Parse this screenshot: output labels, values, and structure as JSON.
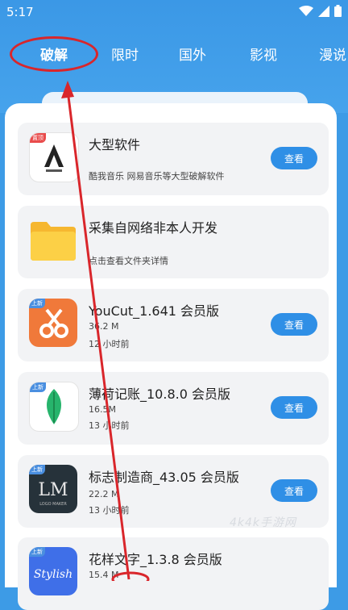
{
  "status": {
    "time": "5:17"
  },
  "tabs": [
    {
      "label": "破解",
      "active": true
    },
    {
      "label": "限时"
    },
    {
      "label": "国外"
    },
    {
      "label": "影视"
    },
    {
      "label": "漫说"
    }
  ],
  "items": [
    {
      "title": "大型软件",
      "line1": "酷我音乐 网易音乐等大型破解软件",
      "line2": "",
      "tag": "置顶",
      "icon": "a-logo-icon",
      "button": "查看"
    },
    {
      "title": "采集自网络非本人开发",
      "line1": "点击查看文件夹详情",
      "line2": "",
      "tag": "",
      "icon": "folder-icon",
      "button": ""
    },
    {
      "title": "YouCut_1.641 会员版",
      "line1": "36.2 M",
      "line2": "12 小时前",
      "tag": "上新",
      "icon": "scissors-icon",
      "button": "查看"
    },
    {
      "title": "薄荷记账_10.8.0 会员版",
      "line1": "16.5M",
      "line2": "13 小时前",
      "tag": "上新",
      "icon": "leaf-icon",
      "button": "查看"
    },
    {
      "title": "标志制造商_43.05 会员版",
      "line1": "22.2 M",
      "line2": "13 小时前",
      "tag": "上新",
      "icon": "lm-logo-icon",
      "button": "查看"
    },
    {
      "title": "花样文字_1.3.8 会员版",
      "line1": "15.4 M",
      "line2": "",
      "tag": "上新",
      "icon": "stylish-icon",
      "button": ""
    }
  ],
  "watermark": "4k4k手游网",
  "colors": {
    "header": "#3d9be6",
    "button": "#2f8fe6",
    "annotation": "#d9262b"
  }
}
